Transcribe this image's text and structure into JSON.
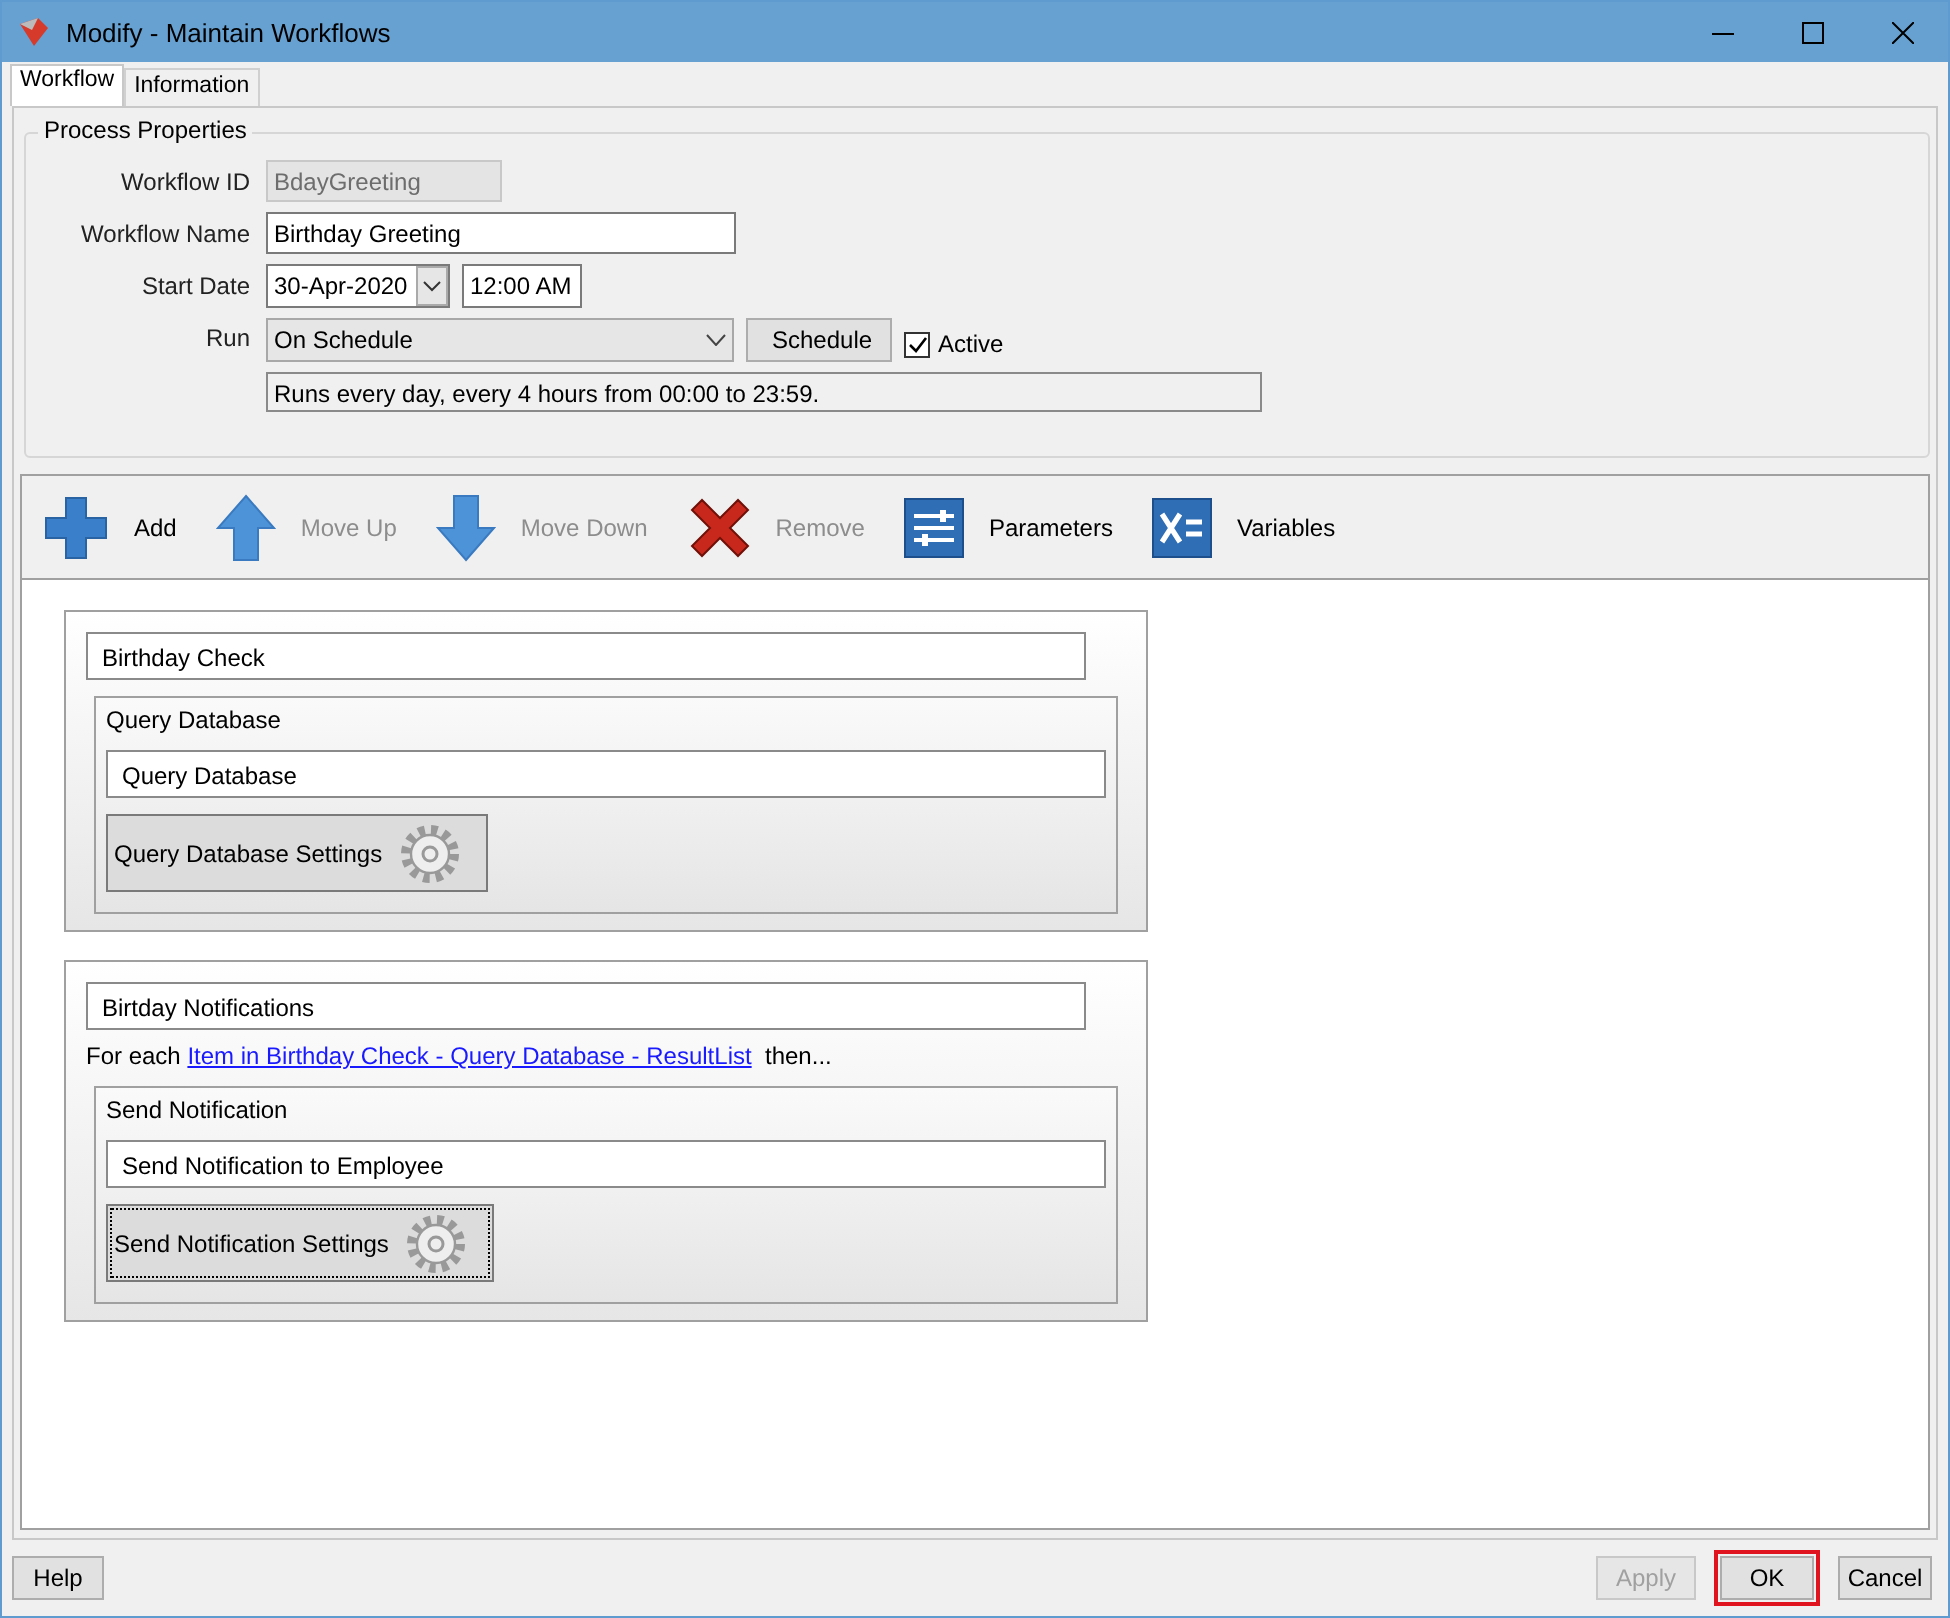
{
  "window": {
    "title": "Modify - Maintain Workflows"
  },
  "tabs": [
    {
      "label": "Workflow",
      "selected": true
    },
    {
      "label": "Information",
      "selected": false
    }
  ],
  "process_properties": {
    "title": "Process Properties",
    "workflow_id": {
      "label": "Workflow ID",
      "value": "BdayGreeting",
      "disabled": true
    },
    "workflow_name": {
      "label": "Workflow Name",
      "value": "Birthday Greeting"
    },
    "start_date": {
      "label": "Start Date",
      "date": "30-Apr-2020",
      "time": "12:00 AM"
    },
    "run": {
      "label": "Run",
      "value": "On Schedule",
      "button": "Schedule",
      "active": {
        "label": "Active",
        "checked": true
      },
      "summary": "Runs every day, every 4 hours from 00:00 to 23:59."
    }
  },
  "toolbar": [
    {
      "kind": "add",
      "label": "Add",
      "disabled": false
    },
    {
      "kind": "up",
      "label": "Move Up",
      "disabled": true
    },
    {
      "kind": "down",
      "label": "Move Down",
      "disabled": true
    },
    {
      "kind": "remove",
      "label": "Remove",
      "disabled": true
    },
    {
      "kind": "parameters",
      "label": "Parameters",
      "disabled": false
    },
    {
      "kind": "variables",
      "label": "Variables",
      "disabled": false
    }
  ],
  "steps": [
    {
      "name": "Birthday Check",
      "actions": [
        {
          "title": "Query Database",
          "name": "Query Database",
          "settings": "Query Database Settings",
          "focused": false
        }
      ]
    },
    {
      "name": "Birtday Notifications",
      "for_each": {
        "prefix": "For each",
        "link": "Item in Birthday Check - Query Database - ResultList",
        "suffix": "then..."
      },
      "actions": [
        {
          "title": "Send Notification",
          "name": "Send Notification to Employee",
          "settings": "Send Notification Settings",
          "focused": true
        }
      ]
    }
  ],
  "footer": {
    "help": "Help",
    "buttons": [
      {
        "label": "Apply",
        "disabled": true,
        "highlighted": false
      },
      {
        "label": "OK",
        "disabled": false,
        "highlighted": true
      },
      {
        "label": "Cancel",
        "disabled": false,
        "highlighted": false
      }
    ]
  }
}
